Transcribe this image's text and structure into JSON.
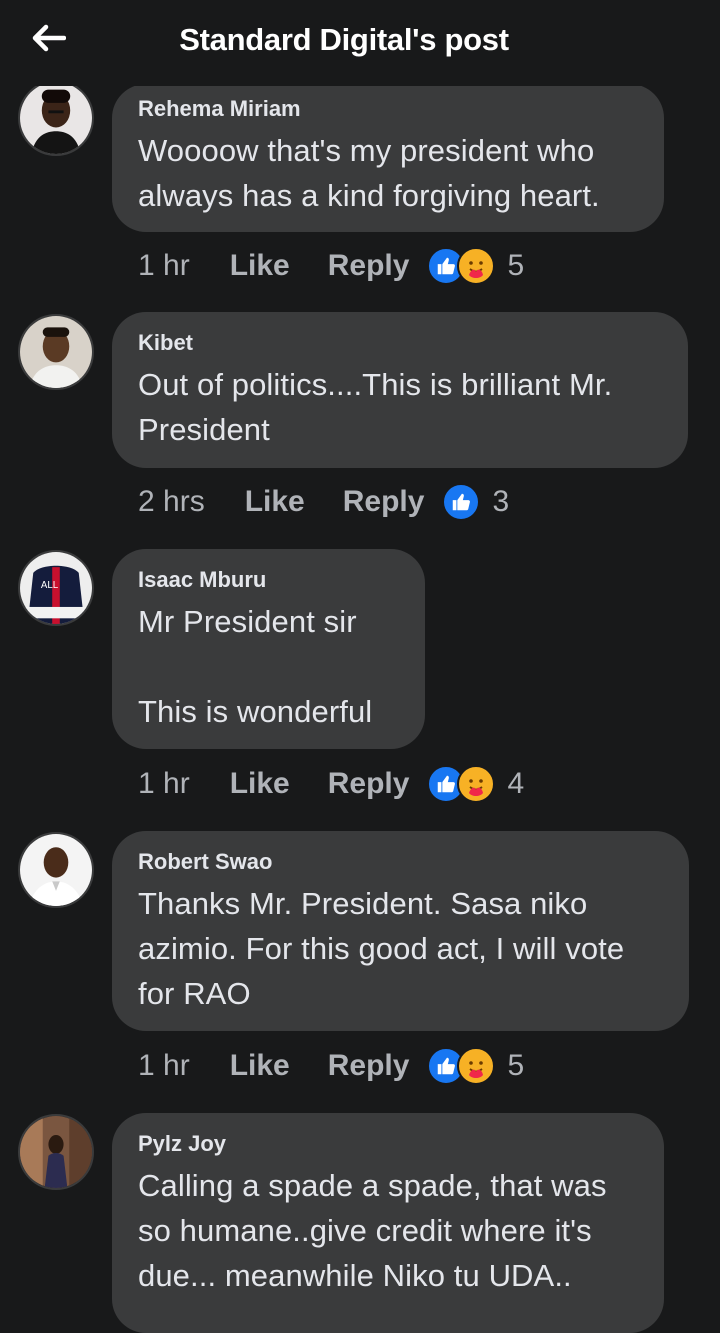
{
  "header": {
    "title": "Standard Digital's post",
    "back_icon": "arrow-left-icon"
  },
  "colors": {
    "background": "#18191a",
    "bubble": "#3a3b3c",
    "like_blue": "#1877f2",
    "care_yellow": "#f7b125",
    "secondary_text": "#b0b3b8"
  },
  "comments": [
    {
      "author": "Rehema Miriam",
      "text": "Woooow that's my president who\nalways has a kind forgiving heart.",
      "time": "1 hr",
      "like_label": "Like",
      "reply_label": "Reply",
      "reactions": [
        "like",
        "care"
      ],
      "count": "5"
    },
    {
      "author": "Kibet",
      "text": "Out of politics....This is brilliant Mr.\nPresident",
      "time": "2 hrs",
      "like_label": "Like",
      "reply_label": "Reply",
      "reactions": [
        "like"
      ],
      "count": "3"
    },
    {
      "author": "Isaac Mburu",
      "text": "Mr President sir\n\nThis is wonderful",
      "time": "1 hr",
      "like_label": "Like",
      "reply_label": "Reply",
      "reactions": [
        "like",
        "care"
      ],
      "count": "4",
      "avatar_text": "ALL"
    },
    {
      "author": "Robert Swao",
      "text": "Thanks Mr. President. Sasa niko\nazimio. For this good act, I will vote\nfor RAO",
      "time": "1 hr",
      "like_label": "Like",
      "reply_label": "Reply",
      "reactions": [
        "like",
        "care"
      ],
      "count": "5"
    },
    {
      "author": "Pylz Joy",
      "text": "Calling a spade a spade, that was\nso humane..give credit where it's\ndue... meanwhile Niko tu UDA..",
      "time": "",
      "like_label": "",
      "reply_label": "",
      "reactions": [],
      "count": ""
    }
  ]
}
